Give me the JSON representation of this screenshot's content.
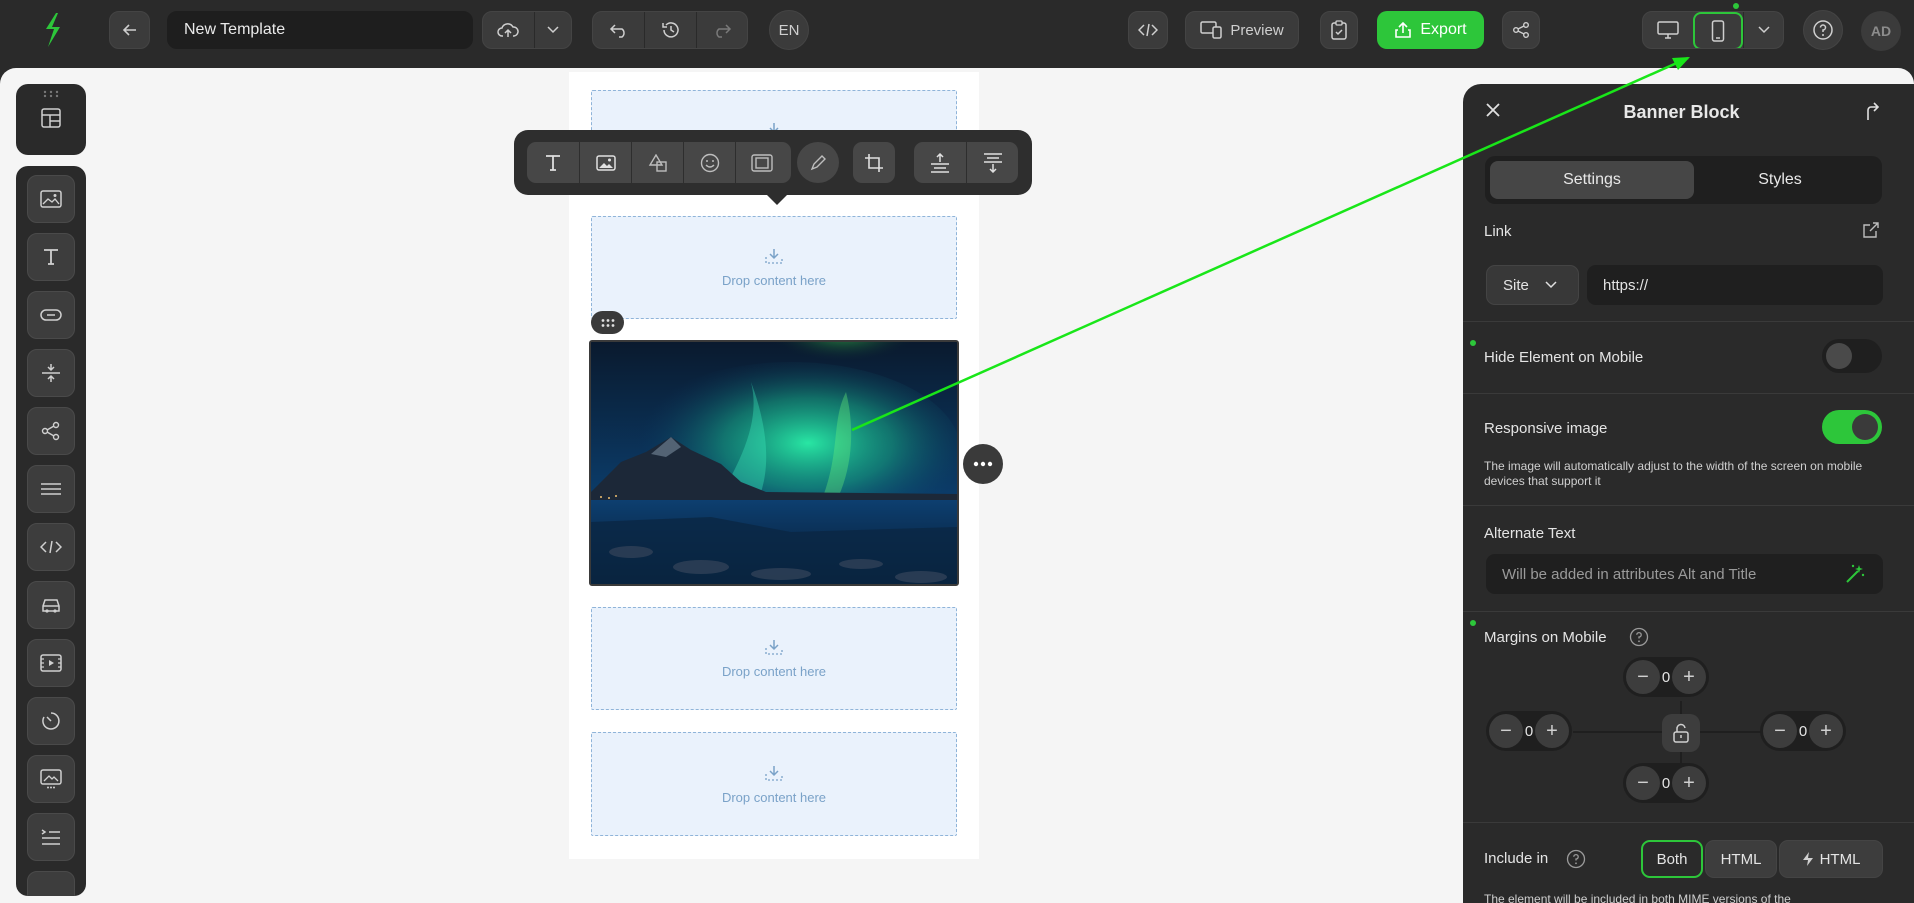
{
  "topbar": {
    "template_title": "New Template",
    "language": "EN",
    "preview_label": "Preview",
    "export_label": "Export",
    "avatar_initials": "AD",
    "accent_color": "#2dc63a"
  },
  "toolbar_icons": [
    "text-icon",
    "image-icon",
    "shapes-icon",
    "emoji-icon",
    "frame-icon",
    "pen-icon",
    "crop-icon",
    "align-top-icon",
    "align-bottom-icon"
  ],
  "canvas": {
    "drop_text": "Drop content here"
  },
  "panel": {
    "title": "Banner Block",
    "tabs": [
      "Settings",
      "Styles"
    ],
    "link_label": "Link",
    "link_type": "Site",
    "link_value": "https://",
    "hide_mobile_label": "Hide Element on Mobile",
    "hide_mobile_on": false,
    "responsive_label": "Responsive image",
    "responsive_on": true,
    "responsive_desc": "The image will automatically adjust to the width of the screen on mobile devices that support it",
    "alt_label": "Alternate Text",
    "alt_placeholder": "Will be added in attributes Alt and Title",
    "margins_label": "Margins on Mobile",
    "margins": {
      "top": "0",
      "left": "0",
      "right": "0",
      "bottom": "0"
    },
    "include_label": "Include in",
    "include_options": [
      "Both",
      "HTML",
      "HTML"
    ],
    "include_selected": "Both",
    "include_desc_partial": "The element will be included in both MIME versions of the"
  }
}
